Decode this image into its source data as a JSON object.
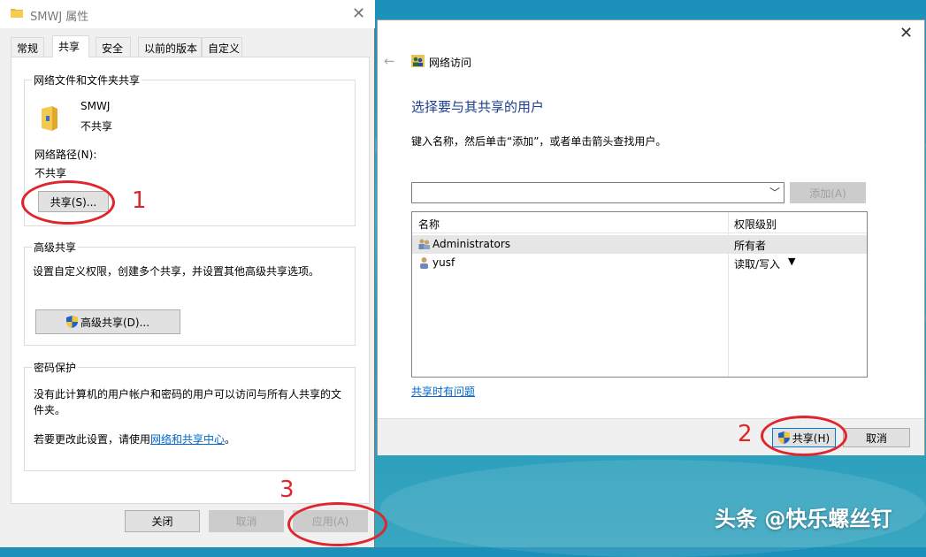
{
  "properties_window": {
    "title": "SMWJ 属性",
    "tabs": [
      {
        "label": "常规"
      },
      {
        "label": "共享",
        "active": true
      },
      {
        "label": "安全"
      },
      {
        "label": "以前的版本"
      },
      {
        "label": "自定义"
      }
    ],
    "network_sharing": {
      "group_title": "网络文件和文件夹共享",
      "folder_name": "SMWJ",
      "share_status": "不共享",
      "path_label": "网络路径(N):",
      "path_value": "不共享",
      "share_button": "共享(S)..."
    },
    "advanced_sharing": {
      "group_title": "高级共享",
      "description": "设置自定义权限，创建多个共享，并设置其他高级共享选项。",
      "button": "高级共享(D)..."
    },
    "password_protection": {
      "group_title": "密码保护",
      "description_line1": "没有此计算机的用户帐户和密码的用户可以访问与所有人共享的文",
      "description_line2": "件夹。",
      "change_prefix": "若要更改此设置，请使用",
      "change_link": "网络和共享中心",
      "change_suffix": "。"
    },
    "buttons": {
      "close": "关闭",
      "cancel": "取消",
      "apply": "应用(A)"
    }
  },
  "network_access_dialog": {
    "title": "网络访问",
    "heading": "选择要与其共享的用户",
    "instruction": "键入名称，然后单击“添加”，或者单击箭头查找用户。",
    "name_input_value": "",
    "add_button": "添加(A)",
    "columns": {
      "name": "名称",
      "permission": "权限级别"
    },
    "users": [
      {
        "name": "Administrators",
        "permission": "所有者",
        "selected": true
      },
      {
        "name": "yusf",
        "permission": "读取/写入",
        "has_dropdown": true
      }
    ],
    "help_link": "共享时有问题",
    "buttons": {
      "share": "共享(H)",
      "cancel": "取消"
    }
  },
  "annotations": {
    "step1": "1",
    "step2": "2",
    "step3": "3"
  },
  "watermark": "头条 @快乐螺丝钉",
  "colors": {
    "accent_red": "#e0262d",
    "link_blue": "#0066cc",
    "heading_blue": "#1e3f8c"
  }
}
